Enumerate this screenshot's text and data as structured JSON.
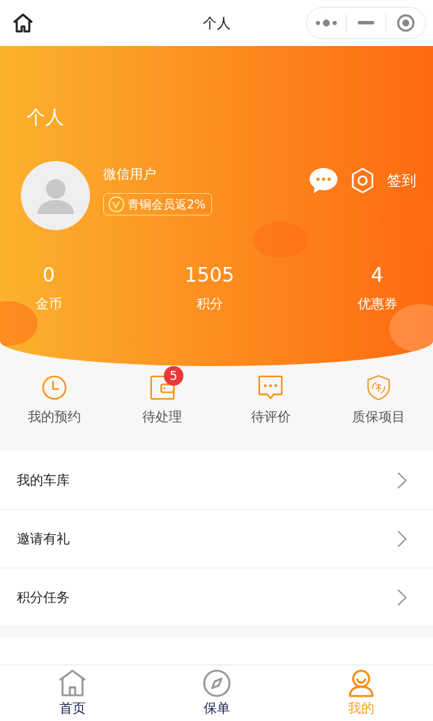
{
  "nav_bar": {
    "title": "个人"
  },
  "header": {
    "title": "个人"
  },
  "profile": {
    "name": "微信用户",
    "member_badge": "青铜会员返2%",
    "checkin": "签到"
  },
  "stats": [
    {
      "value": "0",
      "label": "金币"
    },
    {
      "value": "1505",
      "label": "积分"
    },
    {
      "value": "4",
      "label": "优惠券"
    }
  ],
  "shortcuts": [
    {
      "label": "我的预约"
    },
    {
      "label": "待处理",
      "badge": "5"
    },
    {
      "label": "待评价"
    },
    {
      "label": "质保项目"
    }
  ],
  "menu": [
    {
      "label": "我的车库"
    },
    {
      "label": "邀请有礼"
    },
    {
      "label": "积分任务"
    }
  ],
  "tab_bar": [
    {
      "label": "首页",
      "selected": false
    },
    {
      "label": "保单",
      "selected": false
    },
    {
      "label": "我的",
      "selected": true
    }
  ]
}
